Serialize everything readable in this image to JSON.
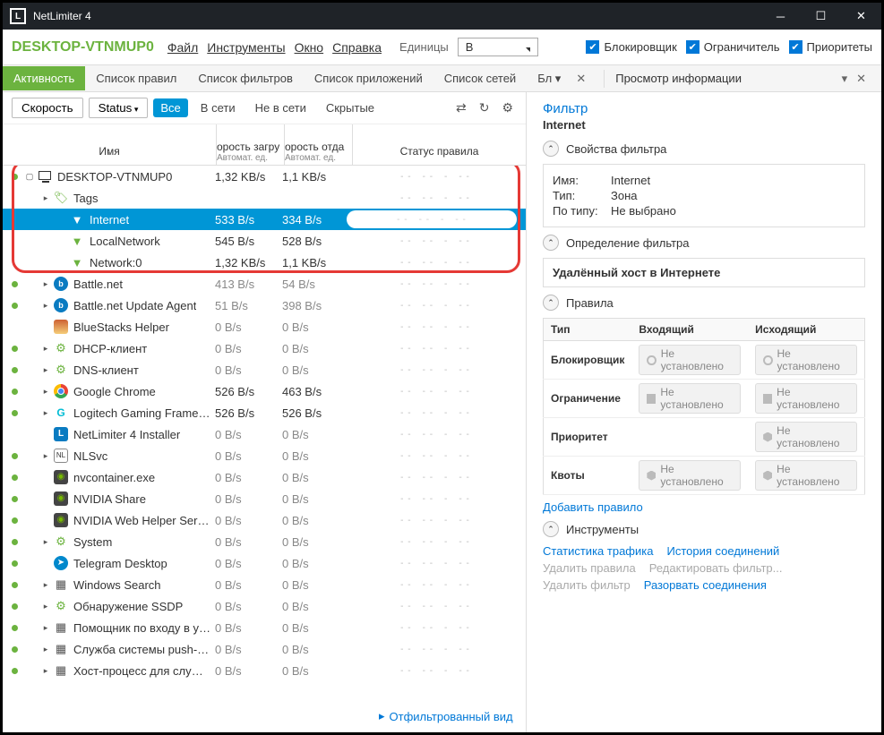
{
  "window": {
    "title": "NetLimiter 4"
  },
  "toolbar": {
    "device": "DESKTOP-VTNMUP0",
    "menu_file": "Файл",
    "menu_tools": "Инструменты",
    "menu_window": "Окно",
    "menu_help": "Справка",
    "units_label": "Единицы",
    "units_value": "B",
    "check_blocker": "Блокировщик",
    "check_limiter": "Ограничитель",
    "check_priority": "Приоритеты"
  },
  "tabs": {
    "activity": "Активность",
    "rules": "Список правил",
    "filters": "Список фильтров",
    "apps": "Список приложений",
    "nets": "Список сетей",
    "more": "Бл",
    "info_title": "Просмотр информации"
  },
  "filterbar": {
    "speed": "Скорость",
    "status": "Status",
    "all": "Все",
    "online": "В сети",
    "offline": "Не в сети",
    "hidden": "Скрытые"
  },
  "columns": {
    "name": "Имя",
    "dl": "орость загру",
    "ul": "орость отда",
    "auto": "Автомат. ед.",
    "status": "Статус правила"
  },
  "rows": [
    {
      "indent": 0,
      "dot": true,
      "exp": "▢",
      "icon": "monitor",
      "name": "DESKTOP-VTNMUP0",
      "dl": "1,32 KB/s",
      "ul": "1,1 KB/s",
      "strong": true
    },
    {
      "indent": 1,
      "dot": false,
      "exp": "▸",
      "icon": "tag",
      "name": "Tags",
      "dl": "",
      "ul": "",
      "strong": false
    },
    {
      "indent": 2,
      "dot": false,
      "exp": "",
      "icon": "filter",
      "name": "Internet",
      "dl": "533 B/s",
      "ul": "334 B/s",
      "strong": true,
      "selected": true
    },
    {
      "indent": 2,
      "dot": false,
      "exp": "",
      "icon": "filter",
      "name": "LocalNetwork",
      "dl": "545 B/s",
      "ul": "528 B/s",
      "strong": true
    },
    {
      "indent": 2,
      "dot": false,
      "exp": "",
      "icon": "filter",
      "name": "Network:0",
      "dl": "1,32 KB/s",
      "ul": "1,1 KB/s",
      "strong": true
    },
    {
      "indent": 1,
      "dot": true,
      "exp": "▸",
      "icon": "bnet",
      "name": "Battle.net",
      "dl": "413 B/s",
      "ul": "54 B/s"
    },
    {
      "indent": 1,
      "dot": true,
      "exp": "▸",
      "icon": "bnet",
      "name": "Battle.net Update Agent",
      "dl": "51 B/s",
      "ul": "398 B/s"
    },
    {
      "indent": 1,
      "dot": false,
      "exp": "",
      "icon": "bluestacks",
      "name": "BlueStacks Helper",
      "dl": "0 B/s",
      "ul": "0 B/s"
    },
    {
      "indent": 1,
      "dot": true,
      "exp": "▸",
      "icon": "gear",
      "name": "DHCP-клиент",
      "dl": "0 B/s",
      "ul": "0 B/s"
    },
    {
      "indent": 1,
      "dot": true,
      "exp": "▸",
      "icon": "gear",
      "name": "DNS-клиент",
      "dl": "0 B/s",
      "ul": "0 B/s"
    },
    {
      "indent": 1,
      "dot": true,
      "exp": "▸",
      "icon": "chrome",
      "name": "Google Chrome",
      "dl": "526 B/s",
      "ul": "463 B/s",
      "strong": true
    },
    {
      "indent": 1,
      "dot": true,
      "exp": "▸",
      "icon": "logitech",
      "name": "Logitech Gaming Framewor",
      "dl": "526 B/s",
      "ul": "526 B/s",
      "strong": true
    },
    {
      "indent": 1,
      "dot": false,
      "exp": "",
      "icon": "nl",
      "name": "NetLimiter 4 Installer",
      "dl": "0 B/s",
      "ul": "0 B/s"
    },
    {
      "indent": 1,
      "dot": true,
      "exp": "▸",
      "icon": "nls",
      "name": "NLSvc",
      "dl": "0 B/s",
      "ul": "0 B/s"
    },
    {
      "indent": 1,
      "dot": true,
      "exp": "",
      "icon": "nv",
      "name": "nvcontainer.exe",
      "dl": "0 B/s",
      "ul": "0 B/s"
    },
    {
      "indent": 1,
      "dot": true,
      "exp": "",
      "icon": "nv",
      "name": "NVIDIA Share",
      "dl": "0 B/s",
      "ul": "0 B/s"
    },
    {
      "indent": 1,
      "dot": true,
      "exp": "",
      "icon": "nv",
      "name": "NVIDIA Web Helper Service",
      "dl": "0 B/s",
      "ul": "0 B/s"
    },
    {
      "indent": 1,
      "dot": true,
      "exp": "▸",
      "icon": "gear",
      "name": "System",
      "dl": "0 B/s",
      "ul": "0 B/s"
    },
    {
      "indent": 1,
      "dot": true,
      "exp": "",
      "icon": "telegram",
      "name": "Telegram Desktop",
      "dl": "0 B/s",
      "ul": "0 B/s"
    },
    {
      "indent": 1,
      "dot": true,
      "exp": "▸",
      "icon": "svc",
      "name": "Windows Search",
      "dl": "0 B/s",
      "ul": "0 B/s"
    },
    {
      "indent": 1,
      "dot": true,
      "exp": "▸",
      "icon": "gear",
      "name": "Обнаружение SSDP",
      "dl": "0 B/s",
      "ul": "0 B/s"
    },
    {
      "indent": 1,
      "dot": true,
      "exp": "▸",
      "icon": "svc",
      "name": "Помощник по входу в уче",
      "dl": "0 B/s",
      "ul": "0 B/s"
    },
    {
      "indent": 1,
      "dot": true,
      "exp": "▸",
      "icon": "svc",
      "name": "Служба системы push-увед",
      "dl": "0 B/s",
      "ul": "0 B/s"
    },
    {
      "indent": 1,
      "dot": true,
      "exp": "▸",
      "icon": "svc",
      "name": "Хост-процесс для служб W",
      "dl": "0 B/s",
      "ul": "0 B/s"
    }
  ],
  "footer_link": "Отфильтрованный вид",
  "right": {
    "filter_title": "Фильтр",
    "filter_name": "Internet",
    "section_props": "Свойства фильтра",
    "prop_name_k": "Имя:",
    "prop_name_v": "Internet",
    "prop_type_k": "Тип:",
    "prop_type_v": "Зона",
    "prop_bytype_k": "По типу:",
    "prop_bytype_v": "Не выбрано",
    "section_def": "Определение фильтра",
    "def_desc": "Удалённый хост в Интернете",
    "section_rules": "Правила",
    "rules_head_type": "Тип",
    "rules_head_in": "Входящий",
    "rules_head_out": "Исходящий",
    "rule_blocker": "Блокировщик",
    "rule_limit": "Ограничение",
    "rule_prio": "Приоритет",
    "rule_quota": "Квоты",
    "rule_notset": "Не установлено",
    "add_rule": "Добавить правило",
    "section_tools": "Инструменты",
    "tool_stats": "Статистика трафика",
    "tool_history": "История соединений",
    "tool_delrules": "Удалить правила",
    "tool_editfilter": "Редактировать фильтр...",
    "tool_delfilter": "Удалить фильтр",
    "tool_disconnect": "Разорвать соединения"
  }
}
